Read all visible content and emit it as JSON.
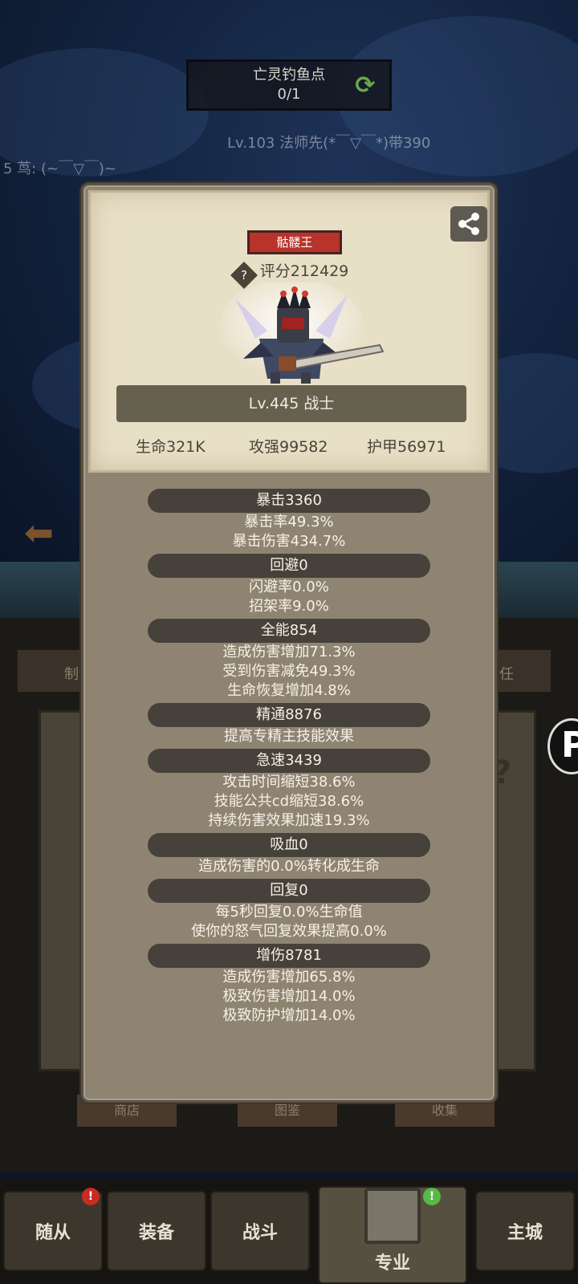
{
  "background": {
    "fishing_spot": {
      "name": "亡灵钓鱼点",
      "progress": "0/1"
    },
    "overlay_line": "Lv.103 法师先(*￣▽￣*)带390",
    "chat_line": "5 茑: (~￣▽￣)~",
    "panel_left": "制",
    "panel_right": "任",
    "behind_tabs": [
      "商店",
      "图鉴",
      "收集"
    ]
  },
  "card": {
    "title_badge": "骷髅王",
    "score": "评分212429",
    "score_icon": "?",
    "level": "Lv.445 战士",
    "stats": {
      "hp": "生命321K",
      "attack": "攻强99582",
      "armor": "护甲56971"
    }
  },
  "groups": [
    {
      "header": "暴击3360",
      "lines": [
        "暴击率49.3%",
        "暴击伤害434.7%"
      ]
    },
    {
      "header": "回避0",
      "lines": [
        "闪避率0.0%",
        "招架率9.0%"
      ]
    },
    {
      "header": "全能854",
      "lines": [
        "造成伤害增加71.3%",
        "受到伤害减免49.3%",
        "生命恢复增加4.8%"
      ]
    },
    {
      "header": "精通8876",
      "lines": [
        "提高专精主技能效果"
      ]
    },
    {
      "header": "急速3439",
      "lines": [
        "攻击时间缩短38.6%",
        "技能公共cd缩短38.6%",
        "持续伤害效果加速19.3%"
      ]
    },
    {
      "header": "吸血0",
      "lines": [
        "造成伤害的0.0%转化成生命"
      ]
    },
    {
      "header": "回复0",
      "lines": [
        "每5秒回复0.0%生命值",
        "使你的怒气回复效果提高0.0%"
      ]
    },
    {
      "header": "增伤8781",
      "lines": [
        "造成伤害增加65.8%",
        "极致伤害增加14.0%",
        "极致防护增加14.0%"
      ]
    }
  ],
  "nav": {
    "followers": "随从",
    "equipment": "装备",
    "battle": "战斗",
    "profession": "专业",
    "main_city": "主城",
    "followers_badge": "!",
    "profession_badge": "!"
  },
  "icons": {
    "share": "share-icon",
    "refresh": "refresh-icon",
    "back": "arrow-left-icon"
  },
  "colors": {
    "card_bg": "#8f8472",
    "badge_red": "#b8332b",
    "header_dark": "#46413a"
  }
}
